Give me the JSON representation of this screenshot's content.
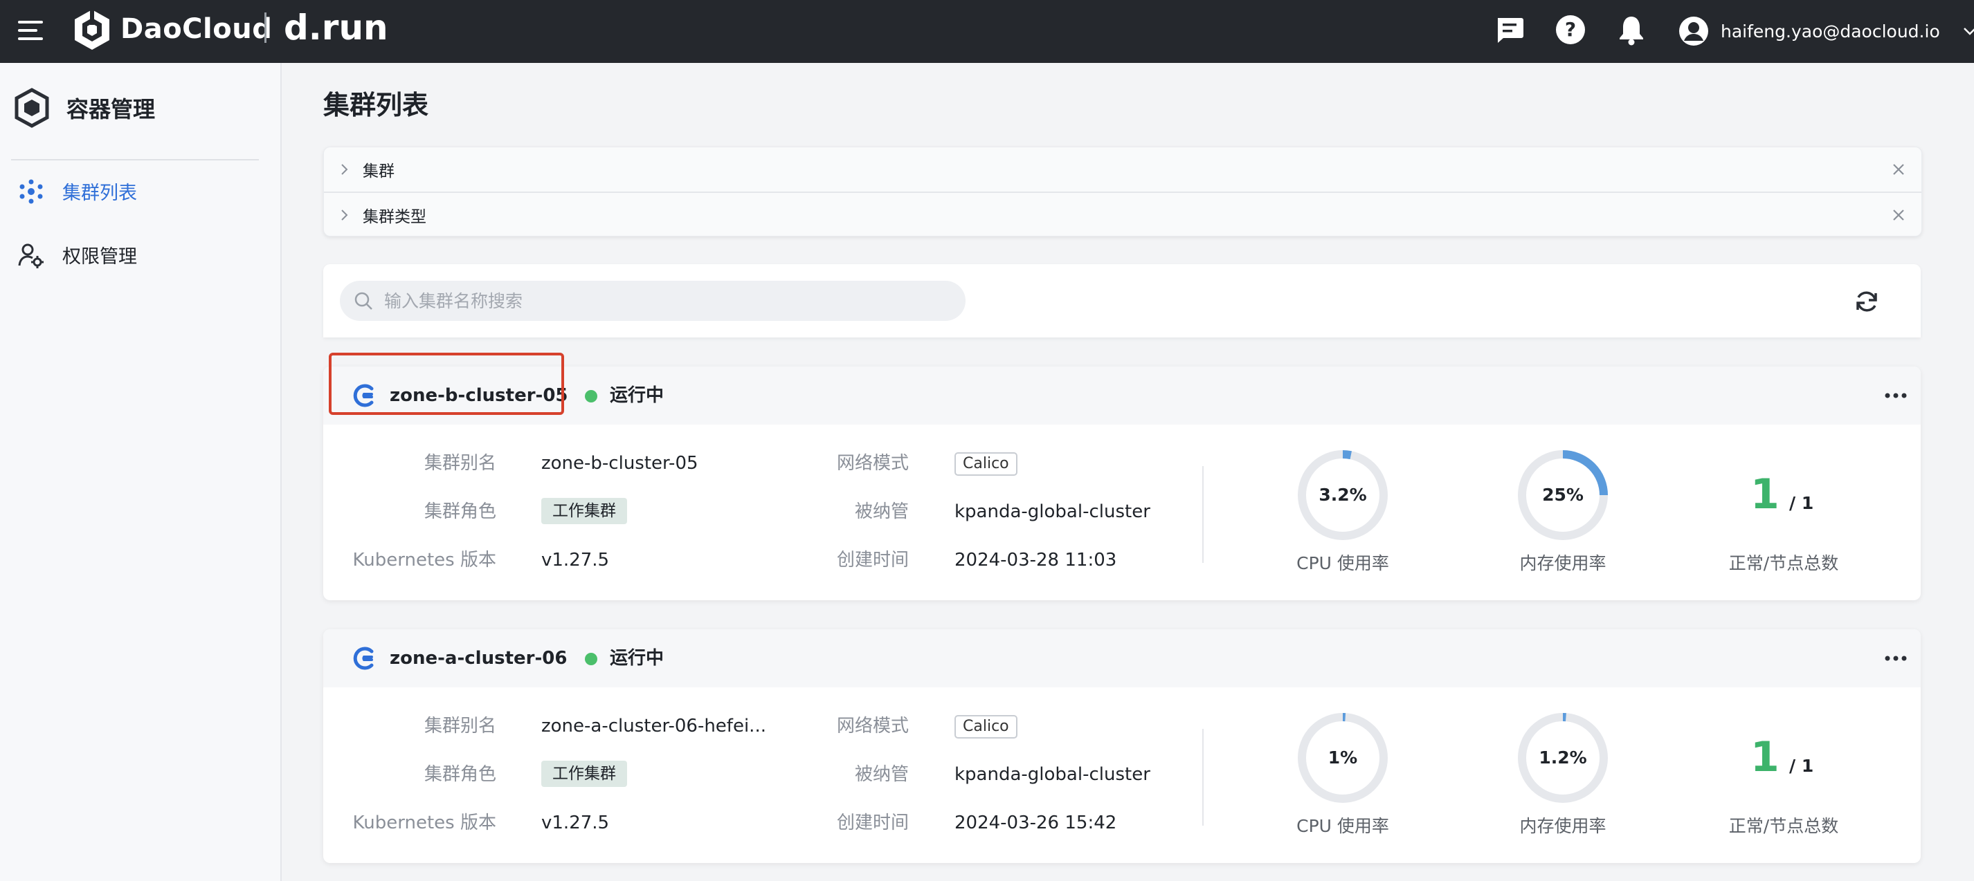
{
  "header": {
    "brand": "DaoCloud",
    "product": "d.run",
    "user_email": "haifeng.yao@daocloud.io",
    "icons": [
      "menu-icon",
      "message-icon",
      "help-icon",
      "bell-icon",
      "user-icon",
      "chevron-down-icon"
    ]
  },
  "sidebar": {
    "title": "容器管理",
    "items": [
      {
        "label": "集群列表",
        "icon": "cluster-icon",
        "active": true
      },
      {
        "label": "权限管理",
        "icon": "permission-icon",
        "active": false
      }
    ]
  },
  "main": {
    "title": "集群列表",
    "filters": [
      {
        "label": "集群"
      },
      {
        "label": "集群类型"
      }
    ],
    "search_placeholder": "输入集群名称搜索",
    "field_labels": {
      "alias": "集群别名",
      "role": "集群角色",
      "k8s_version": "Kubernetes 版本",
      "network": "网络模式",
      "managed_by": "被纳管",
      "created": "创建时间",
      "cpu": "CPU 使用率",
      "memory": "内存使用率",
      "nodes": "正常/节点总数"
    },
    "clusters": [
      {
        "name": "zone-b-cluster-05",
        "status": "运行中",
        "alias": "zone-b-cluster-05",
        "role": "工作集群",
        "k8s_version": "v1.27.5",
        "network": "Calico",
        "managed_by": "kpanda-global-cluster",
        "created": "2024-03-28 11:03",
        "cpu_text": "3.2%",
        "cpu_pct": 3.2,
        "mem_text": "25%",
        "mem_pct": 25,
        "nodes_ready": "1",
        "nodes_total": "/ 1",
        "highlighted": true
      },
      {
        "name": "zone-a-cluster-06",
        "status": "运行中",
        "alias": "zone-a-cluster-06-hefei...",
        "role": "工作集群",
        "k8s_version": "v1.27.5",
        "network": "Calico",
        "managed_by": "kpanda-global-cluster",
        "created": "2024-03-26 15:42",
        "cpu_text": "1%",
        "cpu_pct": 1,
        "mem_text": "1.2%",
        "mem_pct": 1.2,
        "nodes_ready": "1",
        "nodes_total": "/ 1",
        "highlighted": false
      }
    ]
  },
  "colors": {
    "topbar": "#25282d",
    "accent": "#2f6fd8",
    "running": "#4bbf6b",
    "gauge_fill": "#5b9bdc",
    "gauge_track": "#e6e8ec",
    "highlight_box": "#d6412c"
  }
}
